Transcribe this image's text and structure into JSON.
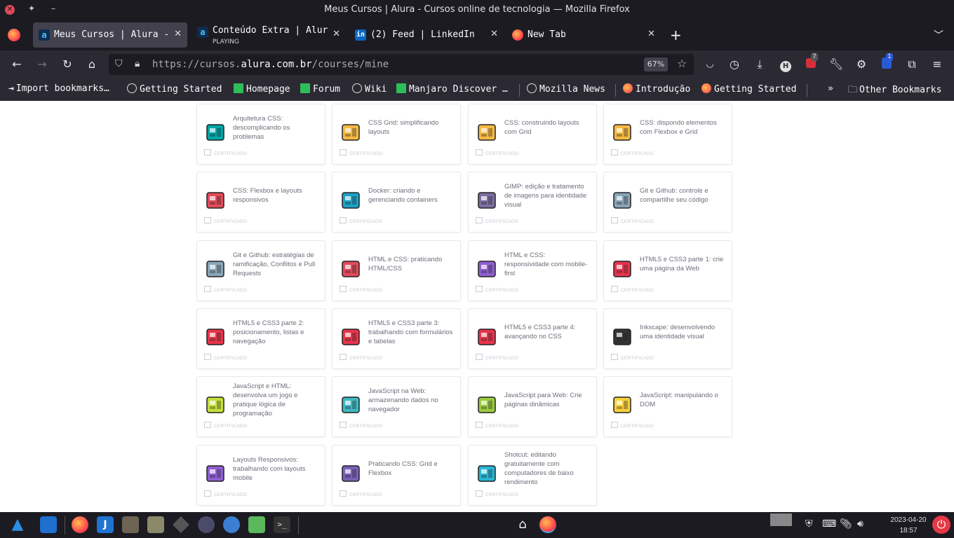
{
  "window": {
    "title": "Meus Cursos | Alura - Cursos online de tecnologia — Mozilla Firefox"
  },
  "tabs": [
    {
      "label": "Meus Cursos | Alura -",
      "icon": "alura-icon",
      "active": true
    },
    {
      "label": "Conteúdo Extra | Alur",
      "sub": "PLAYING",
      "icon": "alura-icon",
      "active": false
    },
    {
      "label": "(2) Feed | LinkedIn",
      "icon": "linkedin-icon",
      "active": false
    },
    {
      "label": "New Tab",
      "icon": "firefox-icon",
      "active": false
    }
  ],
  "navbar": {
    "url_prefix": "https://cursos.",
    "url_domain": "alura.com.br",
    "url_path": "/courses/mine",
    "zoom": "67%",
    "notifications_badge": "7",
    "extension_badge": "1"
  },
  "bookmarks": [
    {
      "label": "Import bookmarks…"
    },
    {
      "label": "Getting Started"
    },
    {
      "label": "Homepage"
    },
    {
      "label": "Forum"
    },
    {
      "label": "Wiki"
    },
    {
      "label": "Manjaro Discover …"
    },
    {
      "label": "Mozilla News"
    },
    {
      "label": "Introdução"
    },
    {
      "label": "Getting Started"
    },
    {
      "label": "Other Bookmarks"
    }
  ],
  "cert_label": "CERTIFICADO",
  "courses": [
    {
      "title": "Arquitetura CSS: descomplicando os problemas",
      "icon_color": "#00a6a6"
    },
    {
      "title": "CSS Grid: simplificando layouts",
      "icon_color": "#f5b942"
    },
    {
      "title": "CSS: construindo layouts com Grid",
      "icon_color": "#f5b942"
    },
    {
      "title": "CSS: dispondo elementos com Flexbox e Grid",
      "icon_color": "#f5b942"
    },
    {
      "title": "CSS: Flexbox e layouts responsivos",
      "icon_color": "#e24a5a"
    },
    {
      "title": "Docker: criando e gerenciando containers",
      "icon_color": "#1da1c7"
    },
    {
      "title": "GIMP: edição e tratamento de imagens para identidade visual",
      "icon_color": "#7a6f9f"
    },
    {
      "title": "Git e Github: controle e compartilhe seu código",
      "icon_color": "#8aa5b8"
    },
    {
      "title": "Git e Github: estratégias de ramificação, Conflitos e Pull Requests",
      "icon_color": "#8aa5b8"
    },
    {
      "title": "HTML e CSS: praticando HTML/CSS",
      "icon_color": "#e24a5a"
    },
    {
      "title": "HTML e CSS: responsividade com mobile-first",
      "icon_color": "#8f5fd1"
    },
    {
      "title": "HTML5 e CSS3 parte 1: crie uma página da Web",
      "icon_color": "#e8344c"
    },
    {
      "title": "HTML5 e CSS3 parte 2: posicionamento, listas e navegação",
      "icon_color": "#e8344c"
    },
    {
      "title": "HTML5 e CSS3 parte 3: trabalhando com formulários e tabelas",
      "icon_color": "#e8344c"
    },
    {
      "title": "HTML5 e CSS3 parte 4: avançando no CSS",
      "icon_color": "#e8344c"
    },
    {
      "title": "Inkscape: desenvolvendo uma identidade visual",
      "icon_color": "#333333"
    },
    {
      "title": "JavaScript e HTML: desenvolva um jogo e pratique lógica de programação",
      "icon_color": "#c4e03b"
    },
    {
      "title": "JavaScript na Web: armazenando dados no navegador",
      "icon_color": "#3fb8c4"
    },
    {
      "title": "JavaScript para Web: Crie páginas dinâmicas",
      "icon_color": "#9ccc3d"
    },
    {
      "title": "JavaScript: manipulando o DOM",
      "icon_color": "#f7d13a"
    },
    {
      "title": "Layouts Responsivos: trabalhando com layouts mobile",
      "icon_color": "#8f5fd1"
    },
    {
      "title": "Praticando CSS: Grid e Flexbox",
      "icon_color": "#7a5fb8"
    },
    {
      "title": "Shotcut: editando gratuitamente com computadores de baixo rendimento",
      "icon_color": "#27b6d6"
    }
  ],
  "taskbar": {
    "date": "2023-04-20",
    "time": "18:57"
  }
}
